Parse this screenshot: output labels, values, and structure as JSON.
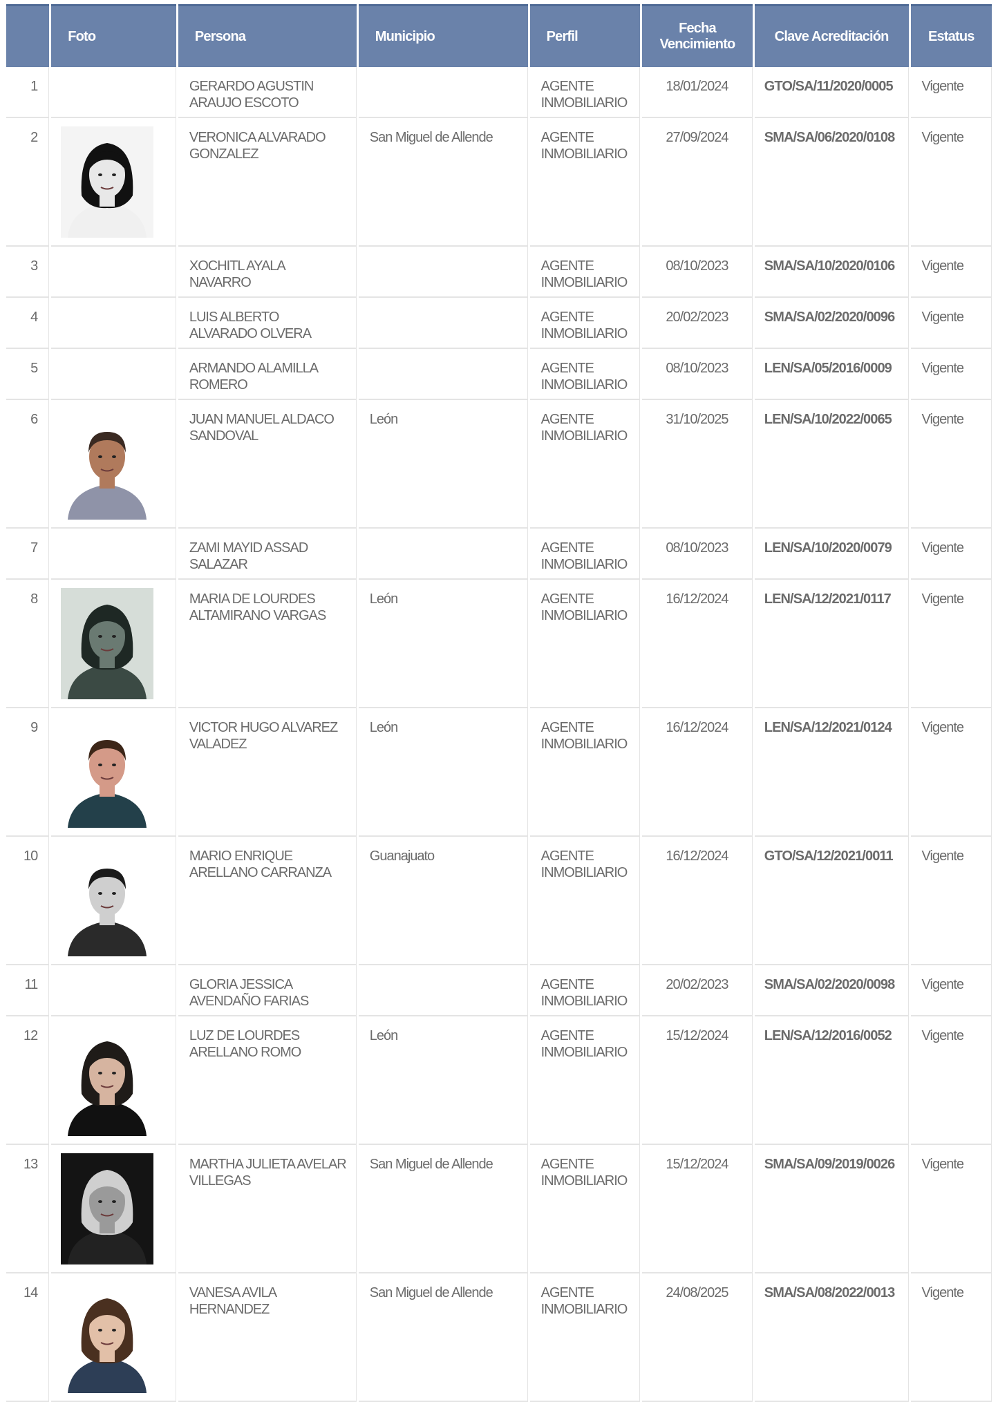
{
  "table": {
    "headers": [
      "",
      "Foto",
      "Persona",
      "Municipio",
      "Perfil",
      "Fecha Vencimiento",
      "Clave Acreditación",
      "Estatus"
    ],
    "rows": [
      {
        "n": "1",
        "persona": "GERARDO AGUSTIN ARAUJO ESCOTO",
        "municipio": "",
        "perfil": "AGENTE INMOBILIARIO",
        "fecha": "18/01/2024",
        "clave": "GTO/SA/11/2020/0005",
        "estatus": "Vigente",
        "photo": ""
      },
      {
        "n": "2",
        "persona": "VERONICA ALVARADO GONZALEZ",
        "municipio": "San Miguel de Allende",
        "perfil": "AGENTE INMOBILIARIO",
        "fecha": "27/09/2024",
        "clave": "SMA/SA/06/2020/0108",
        "estatus": "Vigente",
        "photo": "woman-bw"
      },
      {
        "n": "3",
        "persona": "XOCHITL AYALA NAVARRO",
        "municipio": "",
        "perfil": "AGENTE INMOBILIARIO",
        "fecha": "08/10/2023",
        "clave": "SMA/SA/10/2020/0106",
        "estatus": "Vigente",
        "photo": ""
      },
      {
        "n": "4",
        "persona": "LUIS ALBERTO ALVARADO OLVERA",
        "municipio": "",
        "perfil": "AGENTE INMOBILIARIO",
        "fecha": "20/02/2023",
        "clave": "SMA/SA/02/2020/0096",
        "estatus": "Vigente",
        "photo": ""
      },
      {
        "n": "5",
        "persona": "ARMANDO ALAMILLA ROMERO",
        "municipio": "",
        "perfil": "AGENTE INMOBILIARIO",
        "fecha": "08/10/2023",
        "clave": "LEN/SA/05/2016/0009",
        "estatus": "Vigente",
        "photo": ""
      },
      {
        "n": "6",
        "persona": "JUAN MANUEL ALDACO SANDOVAL",
        "municipio": "León",
        "perfil": "AGENTE INMOBILIARIO",
        "fecha": "31/10/2025",
        "clave": "LEN/SA/10/2022/0065",
        "estatus": "Vigente",
        "photo": "man-color"
      },
      {
        "n": "7",
        "persona": "ZAMI MAYID ASSAD SALAZAR",
        "municipio": "",
        "perfil": "AGENTE INMOBILIARIO",
        "fecha": "08/10/2023",
        "clave": "LEN/SA/10/2020/0079",
        "estatus": "Vigente",
        "photo": ""
      },
      {
        "n": "8",
        "persona": "MARIA DE LOURDES ALTAMIRANO VARGAS",
        "municipio": "León",
        "perfil": "AGENTE INMOBILIARIO",
        "fecha": "16/12/2024",
        "clave": "LEN/SA/12/2021/0117",
        "estatus": "Vigente",
        "photo": "woman-green"
      },
      {
        "n": "9",
        "persona": "VICTOR HUGO ALVAREZ VALADEZ",
        "municipio": "León",
        "perfil": "AGENTE INMOBILIARIO",
        "fecha": "16/12/2024",
        "clave": "LEN/SA/12/2021/0124",
        "estatus": "Vigente",
        "photo": "man-suit"
      },
      {
        "n": "10",
        "persona": "MARIO ENRIQUE ARELLANO CARRANZA",
        "municipio": "Guanajuato",
        "perfil": "AGENTE INMOBILIARIO",
        "fecha": "16/12/2024",
        "clave": "GTO/SA/12/2021/0011",
        "estatus": "Vigente",
        "photo": "man-bw"
      },
      {
        "n": "11",
        "persona": "GLORIA JESSICA AVENDAÑO FARIAS",
        "municipio": "",
        "perfil": "AGENTE INMOBILIARIO",
        "fecha": "20/02/2023",
        "clave": "SMA/SA/02/2020/0098",
        "estatus": "Vigente",
        "photo": ""
      },
      {
        "n": "12",
        "persona": "LUZ DE LOURDES ARELLANO ROMO",
        "municipio": "León",
        "perfil": "AGENTE INMOBILIARIO",
        "fecha": "15/12/2024",
        "clave": "LEN/SA/12/2016/0052",
        "estatus": "Vigente",
        "photo": "woman-color"
      },
      {
        "n": "13",
        "persona": "MARTHA JULIETA AVELAR VILLEGAS",
        "municipio": "San Miguel de Allende",
        "perfil": "AGENTE INMOBILIARIO",
        "fecha": "15/12/2024",
        "clave": "SMA/SA/09/2019/0026",
        "estatus": "Vigente",
        "photo": "woman-dark"
      },
      {
        "n": "14",
        "persona": "VANESA AVILA HERNANDEZ",
        "municipio": "San Miguel de Allende",
        "perfil": "AGENTE INMOBILIARIO",
        "fecha": "24/08/2025",
        "clave": "SMA/SA/08/2022/0013",
        "estatus": "Vigente",
        "photo": "woman-blue"
      }
    ]
  }
}
